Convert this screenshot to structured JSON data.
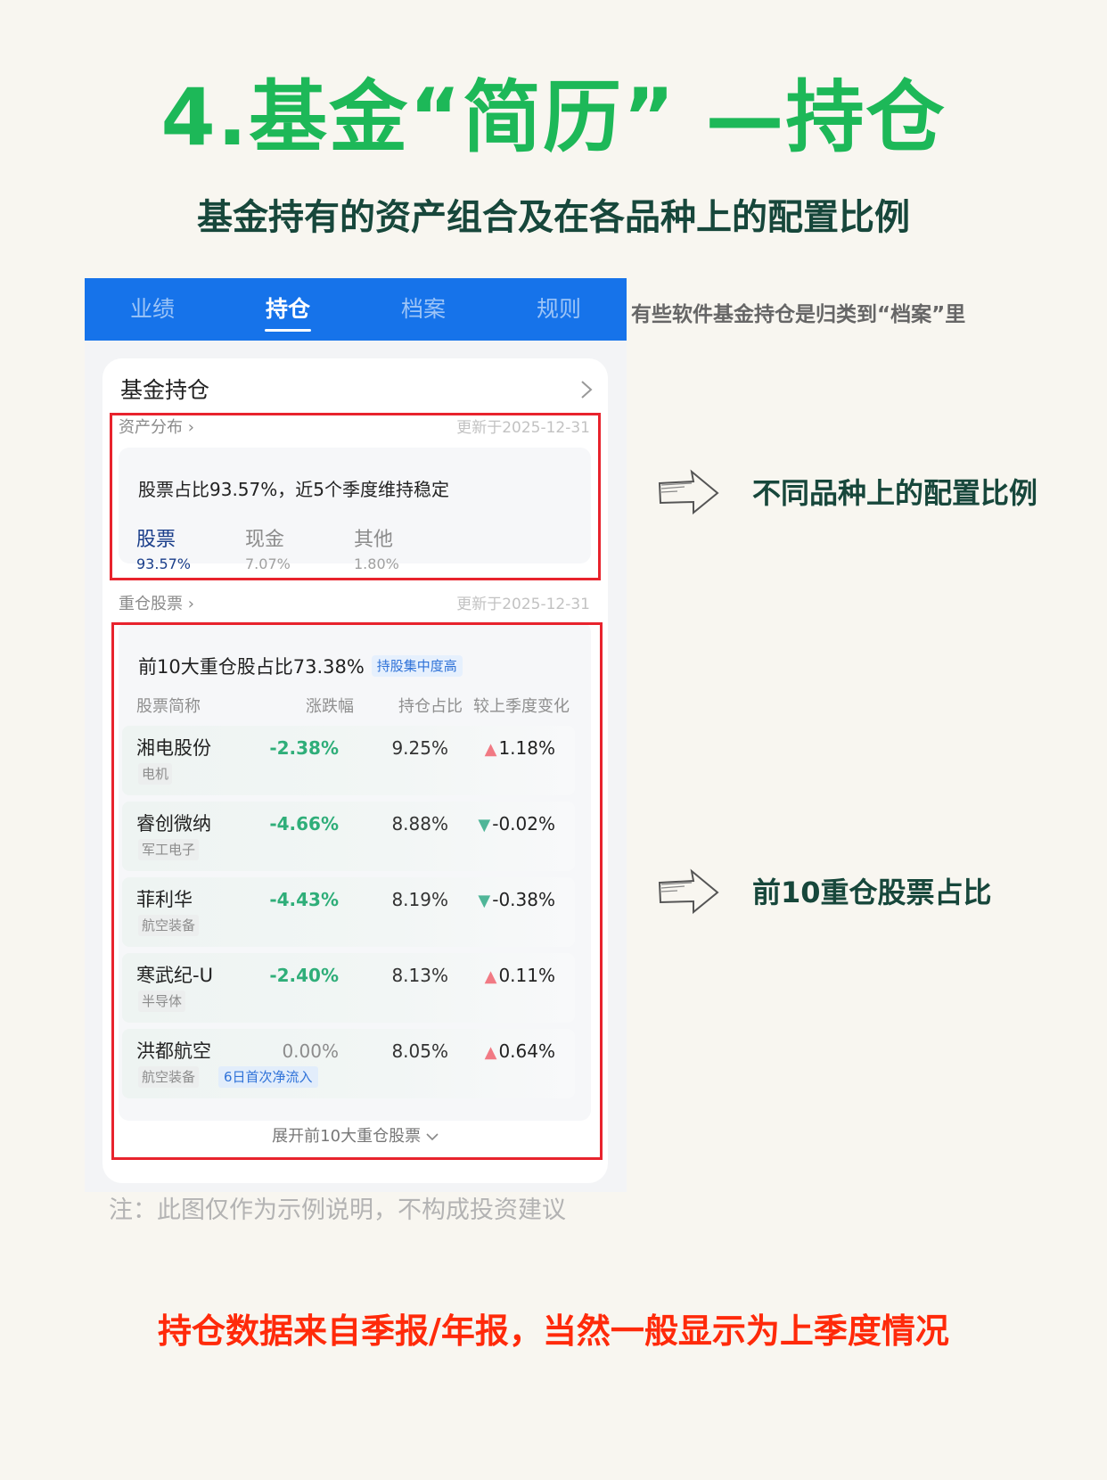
{
  "header": {
    "title": "4.基金“简历” —持仓",
    "subtitle": "基金持有的资产组合及在各品种上的配置比例"
  },
  "app": {
    "tabs": [
      {
        "label": "业绩"
      },
      {
        "label": "持仓"
      },
      {
        "label": "档案"
      },
      {
        "label": "规则"
      }
    ],
    "active_tab": "持仓",
    "card_title": "基金持仓",
    "asset_section": {
      "label": "资产分布",
      "updated": "更新于2025-12-31",
      "summary": "股票占比93.57%，近5个季度维持稳定",
      "assets": [
        {
          "name": "股票",
          "value": "93.57%"
        },
        {
          "name": "现金",
          "value": "7.07%"
        },
        {
          "name": "其他",
          "value": "1.80%"
        }
      ]
    },
    "holdings_section": {
      "label": "重仓股票",
      "updated": "更新于2025-12-31",
      "top10_text": "前10大重仓股占比73.38%",
      "top10_tag": "持股集中度高",
      "columns": [
        "股票简称",
        "涨跌幅",
        "持仓占比",
        "较上季度变化"
      ],
      "rows": [
        {
          "name": "湘电股份",
          "tag": "电机",
          "extra_tag": "",
          "change": "-2.38%",
          "weight": "9.25%",
          "qchange": "1.18%",
          "direction": "up"
        },
        {
          "name": "睿创微纳",
          "tag": "军工电子",
          "extra_tag": "",
          "change": "-4.66%",
          "weight": "8.88%",
          "qchange": "-0.02%",
          "direction": "down"
        },
        {
          "name": "菲利华",
          "tag": "航空装备",
          "extra_tag": "",
          "change": "-4.43%",
          "weight": "8.19%",
          "qchange": "-0.38%",
          "direction": "down"
        },
        {
          "name": "寒武纪-U",
          "tag": "半导体",
          "extra_tag": "",
          "change": "-2.40%",
          "weight": "8.13%",
          "qchange": "0.11%",
          "direction": "up"
        },
        {
          "name": "洪都航空",
          "tag": "航空装备",
          "extra_tag": "6日首次净流入",
          "change": "0.00%",
          "weight": "8.05%",
          "qchange": "0.64%",
          "direction": "up"
        }
      ],
      "expand_label": "展开前10大重仓股票"
    }
  },
  "annotations": {
    "side_note": "有些软件基金持仓是归类到“档案”里",
    "label_allocation": "不同品种上的配置比例",
    "label_top10": "前10重仓股票占比",
    "disclaimer": "注：此图仅作为示例说明，不构成投资建议",
    "footer": "持仓数据来自季报/年报，当然一般显示为上季度情况"
  },
  "colors": {
    "title_green": "#1db858",
    "tab_blue": "#1673ea",
    "highlight_red": "#e8232d",
    "down_green": "#2fae79",
    "footer_red": "#ff2a0a",
    "stock_blue": "#1a3e8a"
  },
  "icons": {
    "card_more": "chevron-right-icon",
    "section_more": "chevron-right-icon",
    "expand": "chevron-down-icon",
    "increase": "arrow-up-icon",
    "decrease": "arrow-down-icon",
    "pointer": "hand-drawn-arrow-icon"
  }
}
